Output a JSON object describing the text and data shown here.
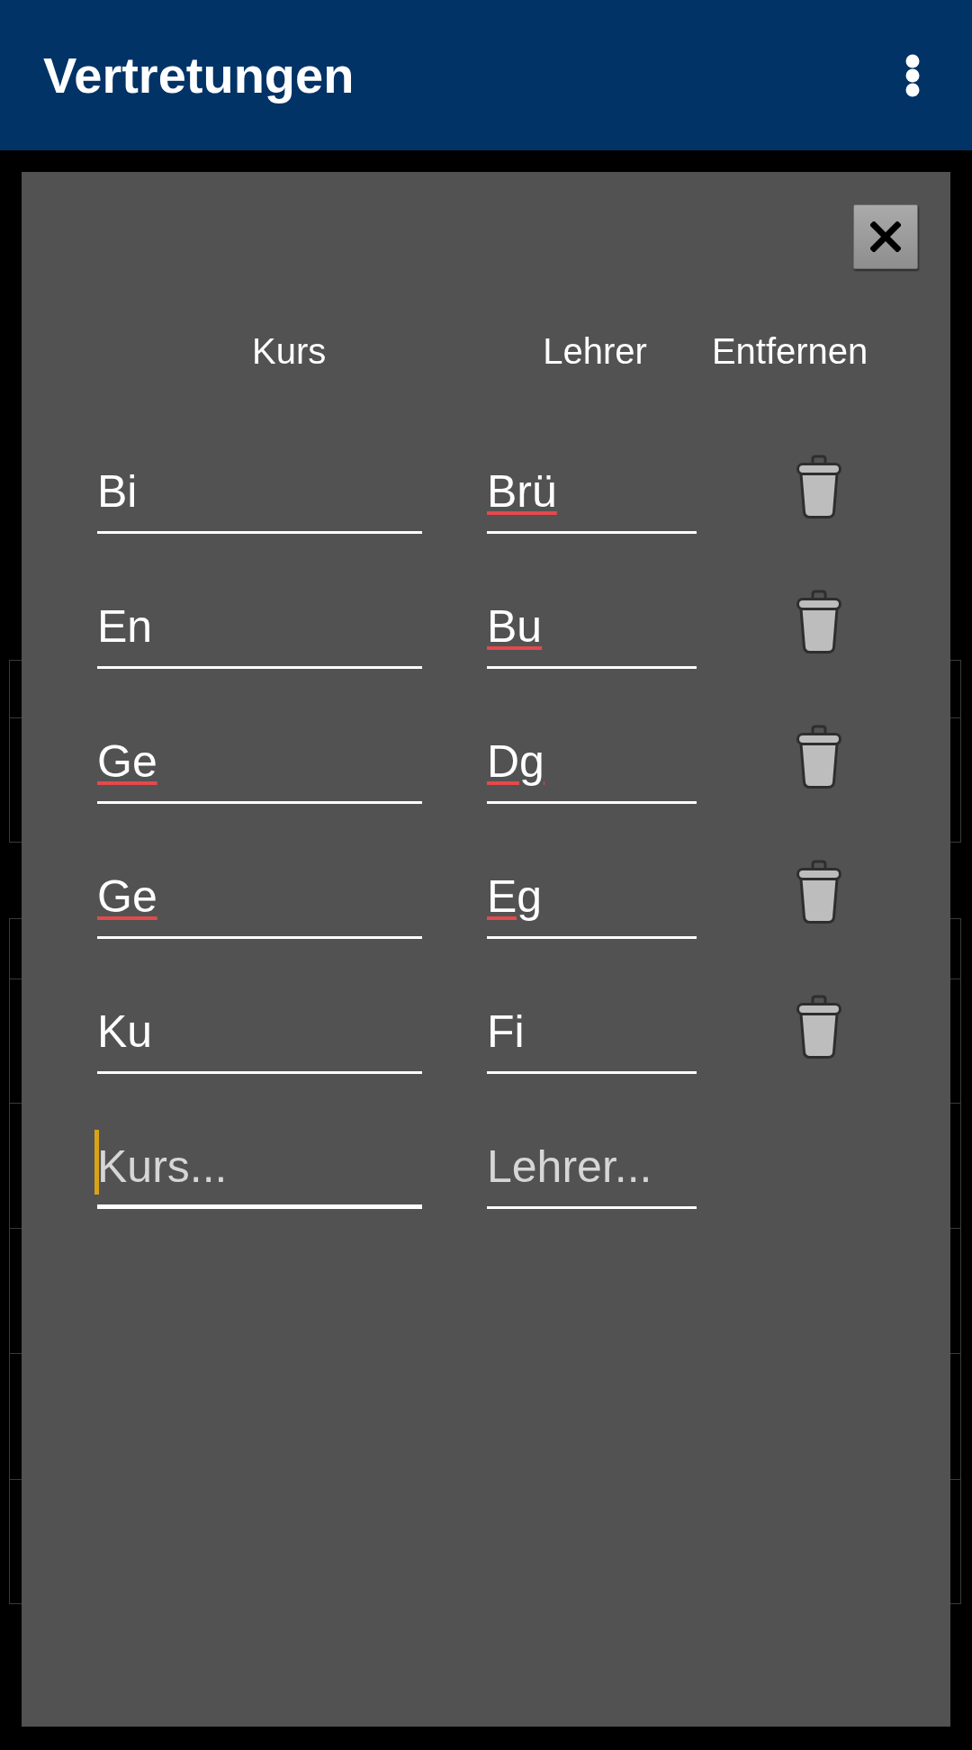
{
  "app_bar": {
    "title": "Vertretungen"
  },
  "dialog": {
    "columns": [
      "Kurs",
      "Lehrer",
      "Entfernen"
    ],
    "entries": [
      {
        "course": {
          "value": "Bi",
          "misspelled": false
        },
        "teacher": {
          "value": "Brü",
          "misspelled": true
        }
      },
      {
        "course": {
          "value": "En",
          "misspelled": false
        },
        "teacher": {
          "value": "Bu",
          "misspelled": true
        }
      },
      {
        "course": {
          "value": "Ge",
          "misspelled": true
        },
        "teacher": {
          "value": "Dg",
          "misspelled": true
        }
      },
      {
        "course": {
          "value": "Ge",
          "misspelled": true
        },
        "teacher": {
          "value": "Eg",
          "misspelled": true
        }
      },
      {
        "course": {
          "value": "Ku",
          "misspelled": false
        },
        "teacher": {
          "value": "Fi",
          "misspelled": false
        }
      }
    ],
    "new_entry": {
      "course": {
        "placeholder": "Kurs...",
        "focused": true
      },
      "teacher": {
        "placeholder": "Lehrer...",
        "focused": false
      }
    }
  }
}
